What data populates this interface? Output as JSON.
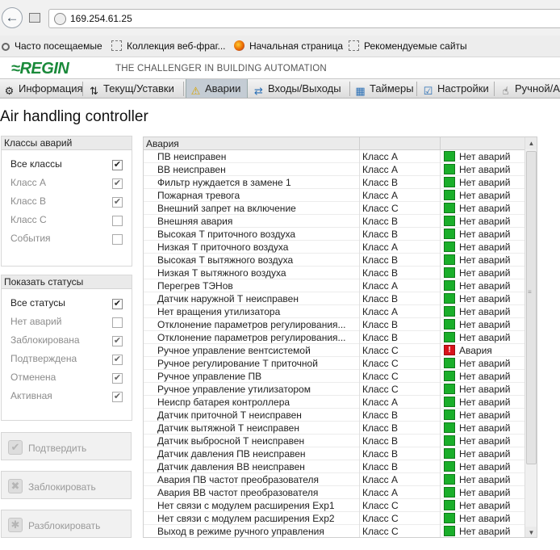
{
  "browser": {
    "url": "169.254.61.25",
    "bookmarks": [
      "Часто посещаемые",
      "Коллекция веб-фраг...",
      "Начальная страница",
      "Рекомендуемые сайты"
    ]
  },
  "header": {
    "logo": "≈REGIN",
    "tagline": "THE CHALLENGER IN BUILDING AUTOMATION"
  },
  "menu": {
    "tabs": [
      {
        "label": "Информация",
        "icon": "gear-icon"
      },
      {
        "label": "Текущ/Уставки",
        "icon": "chart-icon"
      },
      {
        "label": "Аварии",
        "icon": "warning-icon"
      },
      {
        "label": "Входы/Выходы",
        "icon": "arrows-icon"
      },
      {
        "label": "Таймеры",
        "icon": "calendar-icon"
      },
      {
        "label": "Настройки",
        "icon": "checklist-icon"
      },
      {
        "label": "Ручной/А",
        "icon": "hand-icon"
      }
    ],
    "active": "Аварии"
  },
  "page": {
    "title": "Air handling controller"
  },
  "alarm_classes": {
    "title": "Классы аварий",
    "options": [
      {
        "label": "Все классы",
        "checked": "✔"
      },
      {
        "label": "Класс А",
        "checked": "✔"
      },
      {
        "label": "Класс В",
        "checked": "✔"
      },
      {
        "label": "Класс С",
        "checked": ""
      },
      {
        "label": "События",
        "checked": ""
      }
    ]
  },
  "statuses": {
    "title": "Показать статусы",
    "options": [
      {
        "label": "Все статусы",
        "checked": "✔"
      },
      {
        "label": "Нет аварий",
        "checked": ""
      },
      {
        "label": "Заблокирована",
        "checked": "✔"
      },
      {
        "label": "Подтверждена",
        "checked": "✔"
      },
      {
        "label": "Отменена",
        "checked": "✔"
      },
      {
        "label": "Активная",
        "checked": "✔"
      }
    ]
  },
  "actions": {
    "confirm": "Подтвердить",
    "block": "Заблокировать",
    "unblock": "Разблокировать"
  },
  "table": {
    "header": "Авария",
    "rows": [
      {
        "name": "ПВ неисправен",
        "cls": "Класс А",
        "status": "Нет аварий",
        "alarm": false
      },
      {
        "name": "ВВ неисправен",
        "cls": "Класс А",
        "status": "Нет аварий",
        "alarm": false
      },
      {
        "name": "Фильтр нуждается в замене 1",
        "cls": "Класс В",
        "status": "Нет аварий",
        "alarm": false
      },
      {
        "name": "Пожарная тревога",
        "cls": "Класс А",
        "status": "Нет аварий",
        "alarm": false
      },
      {
        "name": "Внешний запрет на включение",
        "cls": "Класс С",
        "status": "Нет аварий",
        "alarm": false
      },
      {
        "name": "Внешняя авария",
        "cls": "Класс В",
        "status": "Нет аварий",
        "alarm": false
      },
      {
        "name": "Высокая Т приточного воздуха",
        "cls": "Класс В",
        "status": "Нет аварий",
        "alarm": false
      },
      {
        "name": "Низкая Т приточного воздуха",
        "cls": "Класс А",
        "status": "Нет аварий",
        "alarm": false
      },
      {
        "name": "Высокая Т вытяжного воздуха",
        "cls": "Класс В",
        "status": "Нет аварий",
        "alarm": false
      },
      {
        "name": "Низкая Т вытяжного воздуха",
        "cls": "Класс В",
        "status": "Нет аварий",
        "alarm": false
      },
      {
        "name": "Перегрев ТЭНов",
        "cls": "Класс А",
        "status": "Нет аварий",
        "alarm": false
      },
      {
        "name": "Датчик наружной Т неисправен",
        "cls": "Класс В",
        "status": "Нет аварий",
        "alarm": false
      },
      {
        "name": "Нет вращения утилизатора",
        "cls": "Класс А",
        "status": "Нет аварий",
        "alarm": false
      },
      {
        "name": "Отклонение параметров регулирования...",
        "cls": "Класс В",
        "status": "Нет аварий",
        "alarm": false
      },
      {
        "name": "Отклонение параметров регулирования...",
        "cls": "Класс В",
        "status": "Нет аварий",
        "alarm": false
      },
      {
        "name": "Ручное управление вентсистемой",
        "cls": "Класс С",
        "status": "Авария",
        "alarm": true
      },
      {
        "name": "Ручное регулирование Т приточной",
        "cls": "Класс С",
        "status": "Нет аварий",
        "alarm": false
      },
      {
        "name": "Ручное управление ПВ",
        "cls": "Класс С",
        "status": "Нет аварий",
        "alarm": false
      },
      {
        "name": "Ручное управление утилизатором",
        "cls": "Класс С",
        "status": "Нет аварий",
        "alarm": false
      },
      {
        "name": "Неиспр батарея контроллера",
        "cls": "Класс А",
        "status": "Нет аварий",
        "alarm": false
      },
      {
        "name": "Датчик приточной Т неисправен",
        "cls": "Класс В",
        "status": "Нет аварий",
        "alarm": false
      },
      {
        "name": "Датчик вытяжной Т неисправен",
        "cls": "Класс В",
        "status": "Нет аварий",
        "alarm": false
      },
      {
        "name": "Датчик выбросной Т неисправен",
        "cls": "Класс В",
        "status": "Нет аварий",
        "alarm": false
      },
      {
        "name": "Датчик давления ПВ неисправен",
        "cls": "Класс В",
        "status": "Нет аварий",
        "alarm": false
      },
      {
        "name": "Датчик давления ВВ неисправен",
        "cls": "Класс В",
        "status": "Нет аварий",
        "alarm": false
      },
      {
        "name": "Авария ПВ частот преобразователя",
        "cls": "Класс А",
        "status": "Нет аварий",
        "alarm": false
      },
      {
        "name": "Авария ВВ частот преобразователя",
        "cls": "Класс А",
        "status": "Нет аварий",
        "alarm": false
      },
      {
        "name": "Нет связи с модулем расширения Exp1",
        "cls": "Класс С",
        "status": "Нет аварий",
        "alarm": false
      },
      {
        "name": "Нет связи с модулем расширения Exp2",
        "cls": "Класс С",
        "status": "Нет аварий",
        "alarm": false
      },
      {
        "name": "Выход в режиме ручного управления",
        "cls": "Класс С",
        "status": "Нет аварий",
        "alarm": false
      }
    ]
  },
  "colors": {
    "ok": "#1aae2a",
    "alarm": "#d8131b",
    "brand": "#1a8a3a"
  }
}
